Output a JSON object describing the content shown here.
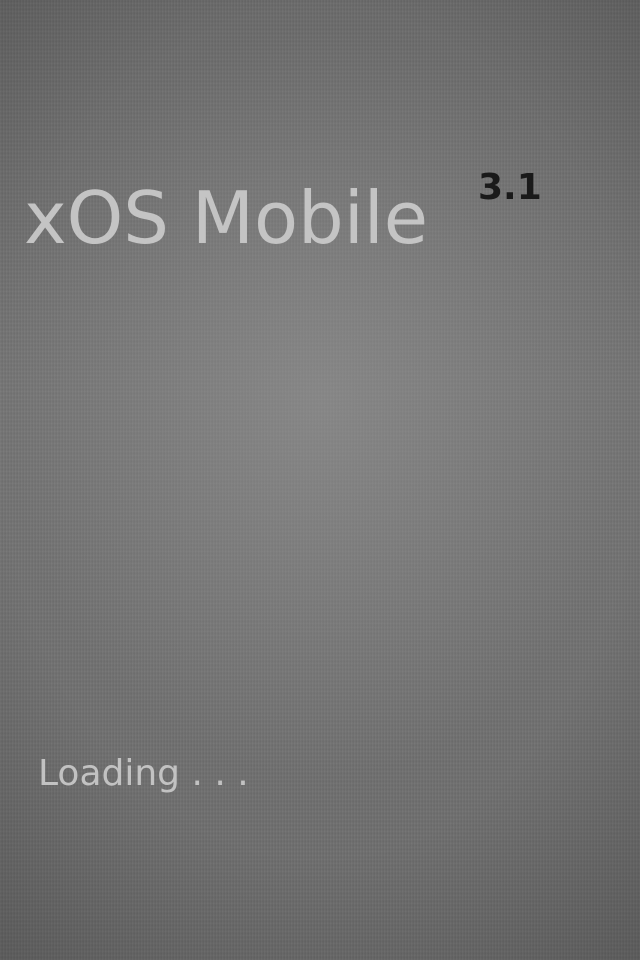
{
  "splash": {
    "title": "xOS Mobile",
    "version": "3.1",
    "loading_text": "Loading . . ."
  },
  "colors": {
    "background": "#6e6e6e",
    "title": "#c4c4c4",
    "version": "#1a1a1a",
    "loading": "#c2c2c2"
  }
}
